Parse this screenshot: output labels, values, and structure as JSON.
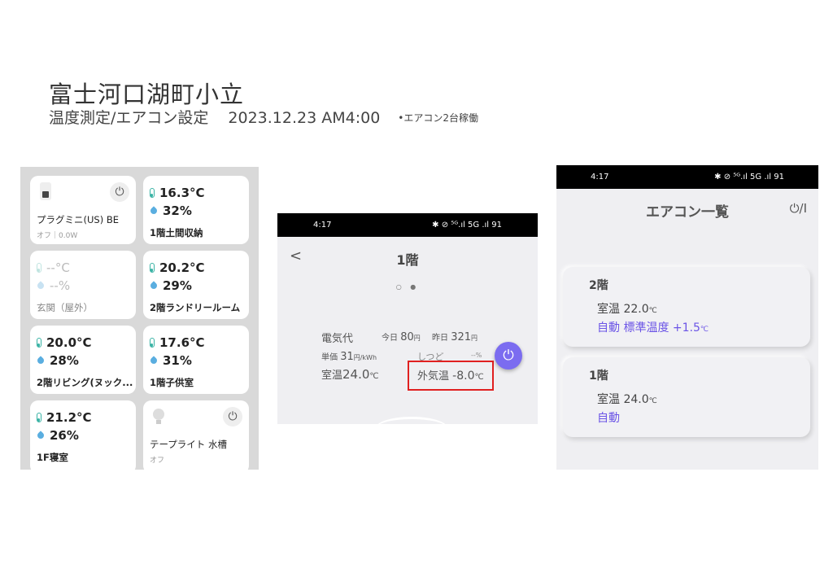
{
  "header": {
    "title": "富士河口湖町小立",
    "subtitle": "温度測定/エアコン設定",
    "datetime": "2023.12.23 AM4:00",
    "note": "•エアコン2台稼働"
  },
  "sensors_panel": {
    "cards": [
      {
        "name": "プラグミニ(US) BE",
        "status": "オフ｜0.0W",
        "power_symbol": "⏻"
      },
      {
        "temp": "16.3°C",
        "humidity": "32%",
        "name": "1階土間収納"
      },
      {
        "temp": "--°C",
        "humidity": "--%",
        "name": "玄関（屋外）"
      },
      {
        "temp": "20.2°C",
        "humidity": "29%",
        "name": "2階ランドリールーム"
      },
      {
        "temp": "20.0°C",
        "humidity": "28%",
        "name": "2階リビング(ヌック..."
      },
      {
        "temp": "17.6°C",
        "humidity": "31%",
        "name": "1階子供室"
      },
      {
        "temp": "21.2°C",
        "humidity": "26%",
        "name": "1F寝室"
      },
      {
        "name": "テープライト 水槽",
        "status": "オフ",
        "power_symbol": "⏻"
      }
    ]
  },
  "ac_detail": {
    "status_bar": {
      "time": "4:17",
      "icons": "✱ ⊘ ⁵ᴳ.ıl 5G .ıl 91"
    },
    "back_label": "<",
    "title": "1階",
    "page_dots": "○ ●",
    "electricity_label": "電気代",
    "today_label": "今日",
    "today_value": "80",
    "yesterday_label": "昨日",
    "yesterday_value": "321",
    "yen_unit": "円",
    "unit_price_label": "単価",
    "unit_price_value": "31",
    "unit_price_unit": "円/kWh",
    "humidity_label": "しつど",
    "humidity_value": "--%",
    "room_temp_label": "室温",
    "room_temp_value": "24.0",
    "deg_unit": "℃",
    "outside_temp_label": "外気温",
    "outside_temp_value": "-8.0",
    "power_symbol": "⏻"
  },
  "ac_list": {
    "status_bar": {
      "time": "4:17",
      "icons": "✱ ⊘ ⁵ᴳ.ıl 5G .ıl 91"
    },
    "title": "エアコン一覧",
    "power_all": "⏻/I",
    "cards": [
      {
        "name": "2階",
        "room_label": "室温",
        "room_value": "22.0",
        "mode_text": "自動 標準温度 +1.5",
        "unit": "℃"
      },
      {
        "name": "1階",
        "room_label": "室温",
        "room_value": "24.0",
        "mode_text": "自動",
        "unit": "℃"
      }
    ]
  },
  "colors": {
    "accent_purple": "#6c55e6",
    "fab_purple": "#7b6cf0",
    "highlight_red": "#e02020",
    "teal": "#38b2a4"
  }
}
